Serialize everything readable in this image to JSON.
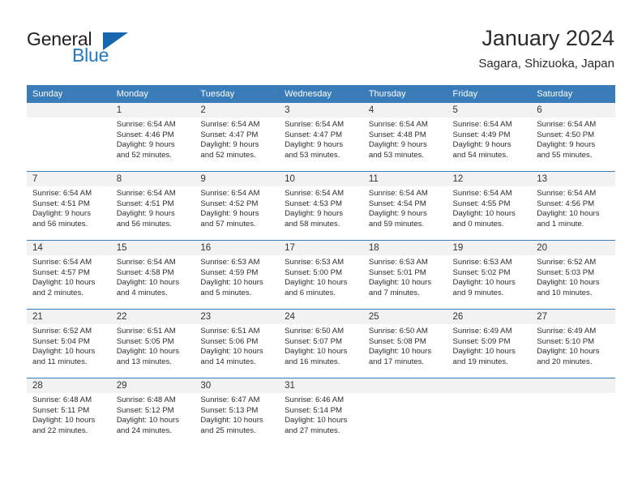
{
  "brand": {
    "name_part1": "General",
    "name_part2": "Blue",
    "accent_color": "#2278c4",
    "triangle_color": "#1567b0"
  },
  "header": {
    "title": "January 2024",
    "subtitle": "Sagara, Shizuoka, Japan"
  },
  "theme": {
    "header_bg": "#3a7cb9",
    "daynum_bg": "#f2f2f2",
    "separator": "#3a7cb9"
  },
  "weekday_headers": [
    "Sunday",
    "Monday",
    "Tuesday",
    "Wednesday",
    "Thursday",
    "Friday",
    "Saturday"
  ],
  "weeks": [
    [
      {
        "day": "",
        "sunrise": "",
        "sunset": "",
        "daylight_line1": "",
        "daylight_line2": ""
      },
      {
        "day": "1",
        "sunrise": "Sunrise: 6:54 AM",
        "sunset": "Sunset: 4:46 PM",
        "daylight_line1": "Daylight: 9 hours",
        "daylight_line2": "and 52 minutes."
      },
      {
        "day": "2",
        "sunrise": "Sunrise: 6:54 AM",
        "sunset": "Sunset: 4:47 PM",
        "daylight_line1": "Daylight: 9 hours",
        "daylight_line2": "and 52 minutes."
      },
      {
        "day": "3",
        "sunrise": "Sunrise: 6:54 AM",
        "sunset": "Sunset: 4:47 PM",
        "daylight_line1": "Daylight: 9 hours",
        "daylight_line2": "and 53 minutes."
      },
      {
        "day": "4",
        "sunrise": "Sunrise: 6:54 AM",
        "sunset": "Sunset: 4:48 PM",
        "daylight_line1": "Daylight: 9 hours",
        "daylight_line2": "and 53 minutes."
      },
      {
        "day": "5",
        "sunrise": "Sunrise: 6:54 AM",
        "sunset": "Sunset: 4:49 PM",
        "daylight_line1": "Daylight: 9 hours",
        "daylight_line2": "and 54 minutes."
      },
      {
        "day": "6",
        "sunrise": "Sunrise: 6:54 AM",
        "sunset": "Sunset: 4:50 PM",
        "daylight_line1": "Daylight: 9 hours",
        "daylight_line2": "and 55 minutes."
      }
    ],
    [
      {
        "day": "7",
        "sunrise": "Sunrise: 6:54 AM",
        "sunset": "Sunset: 4:51 PM",
        "daylight_line1": "Daylight: 9 hours",
        "daylight_line2": "and 56 minutes."
      },
      {
        "day": "8",
        "sunrise": "Sunrise: 6:54 AM",
        "sunset": "Sunset: 4:51 PM",
        "daylight_line1": "Daylight: 9 hours",
        "daylight_line2": "and 56 minutes."
      },
      {
        "day": "9",
        "sunrise": "Sunrise: 6:54 AM",
        "sunset": "Sunset: 4:52 PM",
        "daylight_line1": "Daylight: 9 hours",
        "daylight_line2": "and 57 minutes."
      },
      {
        "day": "10",
        "sunrise": "Sunrise: 6:54 AM",
        "sunset": "Sunset: 4:53 PM",
        "daylight_line1": "Daylight: 9 hours",
        "daylight_line2": "and 58 minutes."
      },
      {
        "day": "11",
        "sunrise": "Sunrise: 6:54 AM",
        "sunset": "Sunset: 4:54 PM",
        "daylight_line1": "Daylight: 9 hours",
        "daylight_line2": "and 59 minutes."
      },
      {
        "day": "12",
        "sunrise": "Sunrise: 6:54 AM",
        "sunset": "Sunset: 4:55 PM",
        "daylight_line1": "Daylight: 10 hours",
        "daylight_line2": "and 0 minutes."
      },
      {
        "day": "13",
        "sunrise": "Sunrise: 6:54 AM",
        "sunset": "Sunset: 4:56 PM",
        "daylight_line1": "Daylight: 10 hours",
        "daylight_line2": "and 1 minute."
      }
    ],
    [
      {
        "day": "14",
        "sunrise": "Sunrise: 6:54 AM",
        "sunset": "Sunset: 4:57 PM",
        "daylight_line1": "Daylight: 10 hours",
        "daylight_line2": "and 2 minutes."
      },
      {
        "day": "15",
        "sunrise": "Sunrise: 6:54 AM",
        "sunset": "Sunset: 4:58 PM",
        "daylight_line1": "Daylight: 10 hours",
        "daylight_line2": "and 4 minutes."
      },
      {
        "day": "16",
        "sunrise": "Sunrise: 6:53 AM",
        "sunset": "Sunset: 4:59 PM",
        "daylight_line1": "Daylight: 10 hours",
        "daylight_line2": "and 5 minutes."
      },
      {
        "day": "17",
        "sunrise": "Sunrise: 6:53 AM",
        "sunset": "Sunset: 5:00 PM",
        "daylight_line1": "Daylight: 10 hours",
        "daylight_line2": "and 6 minutes."
      },
      {
        "day": "18",
        "sunrise": "Sunrise: 6:53 AM",
        "sunset": "Sunset: 5:01 PM",
        "daylight_line1": "Daylight: 10 hours",
        "daylight_line2": "and 7 minutes."
      },
      {
        "day": "19",
        "sunrise": "Sunrise: 6:53 AM",
        "sunset": "Sunset: 5:02 PM",
        "daylight_line1": "Daylight: 10 hours",
        "daylight_line2": "and 9 minutes."
      },
      {
        "day": "20",
        "sunrise": "Sunrise: 6:52 AM",
        "sunset": "Sunset: 5:03 PM",
        "daylight_line1": "Daylight: 10 hours",
        "daylight_line2": "and 10 minutes."
      }
    ],
    [
      {
        "day": "21",
        "sunrise": "Sunrise: 6:52 AM",
        "sunset": "Sunset: 5:04 PM",
        "daylight_line1": "Daylight: 10 hours",
        "daylight_line2": "and 11 minutes."
      },
      {
        "day": "22",
        "sunrise": "Sunrise: 6:51 AM",
        "sunset": "Sunset: 5:05 PM",
        "daylight_line1": "Daylight: 10 hours",
        "daylight_line2": "and 13 minutes."
      },
      {
        "day": "23",
        "sunrise": "Sunrise: 6:51 AM",
        "sunset": "Sunset: 5:06 PM",
        "daylight_line1": "Daylight: 10 hours",
        "daylight_line2": "and 14 minutes."
      },
      {
        "day": "24",
        "sunrise": "Sunrise: 6:50 AM",
        "sunset": "Sunset: 5:07 PM",
        "daylight_line1": "Daylight: 10 hours",
        "daylight_line2": "and 16 minutes."
      },
      {
        "day": "25",
        "sunrise": "Sunrise: 6:50 AM",
        "sunset": "Sunset: 5:08 PM",
        "daylight_line1": "Daylight: 10 hours",
        "daylight_line2": "and 17 minutes."
      },
      {
        "day": "26",
        "sunrise": "Sunrise: 6:49 AM",
        "sunset": "Sunset: 5:09 PM",
        "daylight_line1": "Daylight: 10 hours",
        "daylight_line2": "and 19 minutes."
      },
      {
        "day": "27",
        "sunrise": "Sunrise: 6:49 AM",
        "sunset": "Sunset: 5:10 PM",
        "daylight_line1": "Daylight: 10 hours",
        "daylight_line2": "and 20 minutes."
      }
    ],
    [
      {
        "day": "28",
        "sunrise": "Sunrise: 6:48 AM",
        "sunset": "Sunset: 5:11 PM",
        "daylight_line1": "Daylight: 10 hours",
        "daylight_line2": "and 22 minutes."
      },
      {
        "day": "29",
        "sunrise": "Sunrise: 6:48 AM",
        "sunset": "Sunset: 5:12 PM",
        "daylight_line1": "Daylight: 10 hours",
        "daylight_line2": "and 24 minutes."
      },
      {
        "day": "30",
        "sunrise": "Sunrise: 6:47 AM",
        "sunset": "Sunset: 5:13 PM",
        "daylight_line1": "Daylight: 10 hours",
        "daylight_line2": "and 25 minutes."
      },
      {
        "day": "31",
        "sunrise": "Sunrise: 6:46 AM",
        "sunset": "Sunset: 5:14 PM",
        "daylight_line1": "Daylight: 10 hours",
        "daylight_line2": "and 27 minutes."
      },
      {
        "day": "",
        "sunrise": "",
        "sunset": "",
        "daylight_line1": "",
        "daylight_line2": ""
      },
      {
        "day": "",
        "sunrise": "",
        "sunset": "",
        "daylight_line1": "",
        "daylight_line2": ""
      },
      {
        "day": "",
        "sunrise": "",
        "sunset": "",
        "daylight_line1": "",
        "daylight_line2": ""
      }
    ]
  ]
}
